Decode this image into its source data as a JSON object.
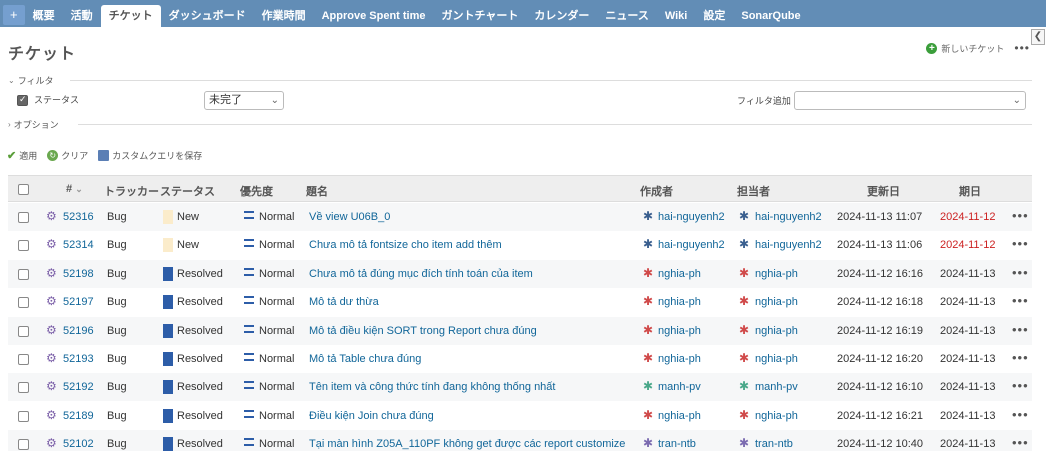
{
  "nav": {
    "plus": "+",
    "items": [
      "概要",
      "活動",
      "チケット",
      "ダッシュボード",
      "作業時間",
      "Approve Spent time",
      "ガントチャート",
      "カレンダー",
      "ニュース",
      "Wiki",
      "設定",
      "SonarQube"
    ],
    "selected_index": 2
  },
  "page": {
    "title": "チケット",
    "new_issue": "新しいチケット",
    "more": "•••"
  },
  "filters": {
    "legend": "フィルタ",
    "status_label": "ステータス",
    "status_value": "未完了",
    "add_filter_label": "フィルタ追加",
    "add_filter_value": ""
  },
  "options": {
    "legend": "オプション"
  },
  "actions": {
    "apply": "適用",
    "clear": "クリア",
    "save_query": "カスタムクエリを保存"
  },
  "table": {
    "headers": {
      "id": "#",
      "tracker": "トラッカー",
      "status": "ステータス",
      "priority": "優先度",
      "subject": "題名",
      "author": "作成者",
      "assignee": "担当者",
      "updated": "更新日",
      "due": "期日"
    },
    "rows": [
      {
        "id": "52316",
        "tracker": "Bug",
        "status": "New",
        "status_kind": "new",
        "priority": "Normal",
        "subject": "Về view U06B_0",
        "author": "hai-nguyenh2",
        "assignee": "hai-nguyenh2",
        "updated": "2024-11-13 11:07",
        "due": "2024-11-12",
        "overdue": true,
        "avatar_color": "#3a5f8f"
      },
      {
        "id": "52314",
        "tracker": "Bug",
        "status": "New",
        "status_kind": "new",
        "priority": "Normal",
        "subject": "Chưa mô tả fontsize cho item add thêm",
        "author": "hai-nguyenh2",
        "assignee": "hai-nguyenh2",
        "updated": "2024-11-13 11:06",
        "due": "2024-11-12",
        "overdue": true,
        "avatar_color": "#3a5f8f"
      },
      {
        "id": "52198",
        "tracker": "Bug",
        "status": "Resolved",
        "status_kind": "resolved",
        "priority": "Normal",
        "subject": "Chưa mô tả đúng mục đích tính toán của item",
        "author": "nghia-ph",
        "assignee": "nghia-ph",
        "updated": "2024-11-12 16:16",
        "due": "2024-11-13",
        "overdue": false,
        "avatar_color": "#d04a4a"
      },
      {
        "id": "52197",
        "tracker": "Bug",
        "status": "Resolved",
        "status_kind": "resolved",
        "priority": "Normal",
        "subject": "Mô tả dư thừa",
        "author": "nghia-ph",
        "assignee": "nghia-ph",
        "updated": "2024-11-12 16:18",
        "due": "2024-11-13",
        "overdue": false,
        "avatar_color": "#d04a4a"
      },
      {
        "id": "52196",
        "tracker": "Bug",
        "status": "Resolved",
        "status_kind": "resolved",
        "priority": "Normal",
        "subject": "Mô tả điều kiện SORT trong Report chưa đúng",
        "author": "nghia-ph",
        "assignee": "nghia-ph",
        "updated": "2024-11-12 16:19",
        "due": "2024-11-13",
        "overdue": false,
        "avatar_color": "#d04a4a"
      },
      {
        "id": "52193",
        "tracker": "Bug",
        "status": "Resolved",
        "status_kind": "resolved",
        "priority": "Normal",
        "subject": "Mô tả Table chưa đúng",
        "author": "nghia-ph",
        "assignee": "nghia-ph",
        "updated": "2024-11-12 16:20",
        "due": "2024-11-13",
        "overdue": false,
        "avatar_color": "#d04a4a"
      },
      {
        "id": "52192",
        "tracker": "Bug",
        "status": "Resolved",
        "status_kind": "resolved",
        "priority": "Normal",
        "subject": "Tên item và công thức tính đang không thống nhất",
        "author": "manh-pv",
        "assignee": "manh-pv",
        "updated": "2024-11-12 16:10",
        "due": "2024-11-13",
        "overdue": false,
        "avatar_color": "#4aa88a"
      },
      {
        "id": "52189",
        "tracker": "Bug",
        "status": "Resolved",
        "status_kind": "resolved",
        "priority": "Normal",
        "subject": "Điều kiện Join chưa đúng",
        "author": "nghia-ph",
        "assignee": "nghia-ph",
        "updated": "2024-11-12 16:21",
        "due": "2024-11-13",
        "overdue": false,
        "avatar_color": "#d04a4a"
      },
      {
        "id": "52102",
        "tracker": "Bug",
        "status": "Resolved",
        "status_kind": "resolved",
        "priority": "Normal",
        "subject": "Tại màn hình Z05A_110PF không get được các report customize",
        "author": "tran-ntb",
        "assignee": "tran-ntb",
        "updated": "2024-11-12 10:40",
        "due": "2024-11-13",
        "overdue": false,
        "avatar_color": "#7b6bb0"
      }
    ]
  }
}
